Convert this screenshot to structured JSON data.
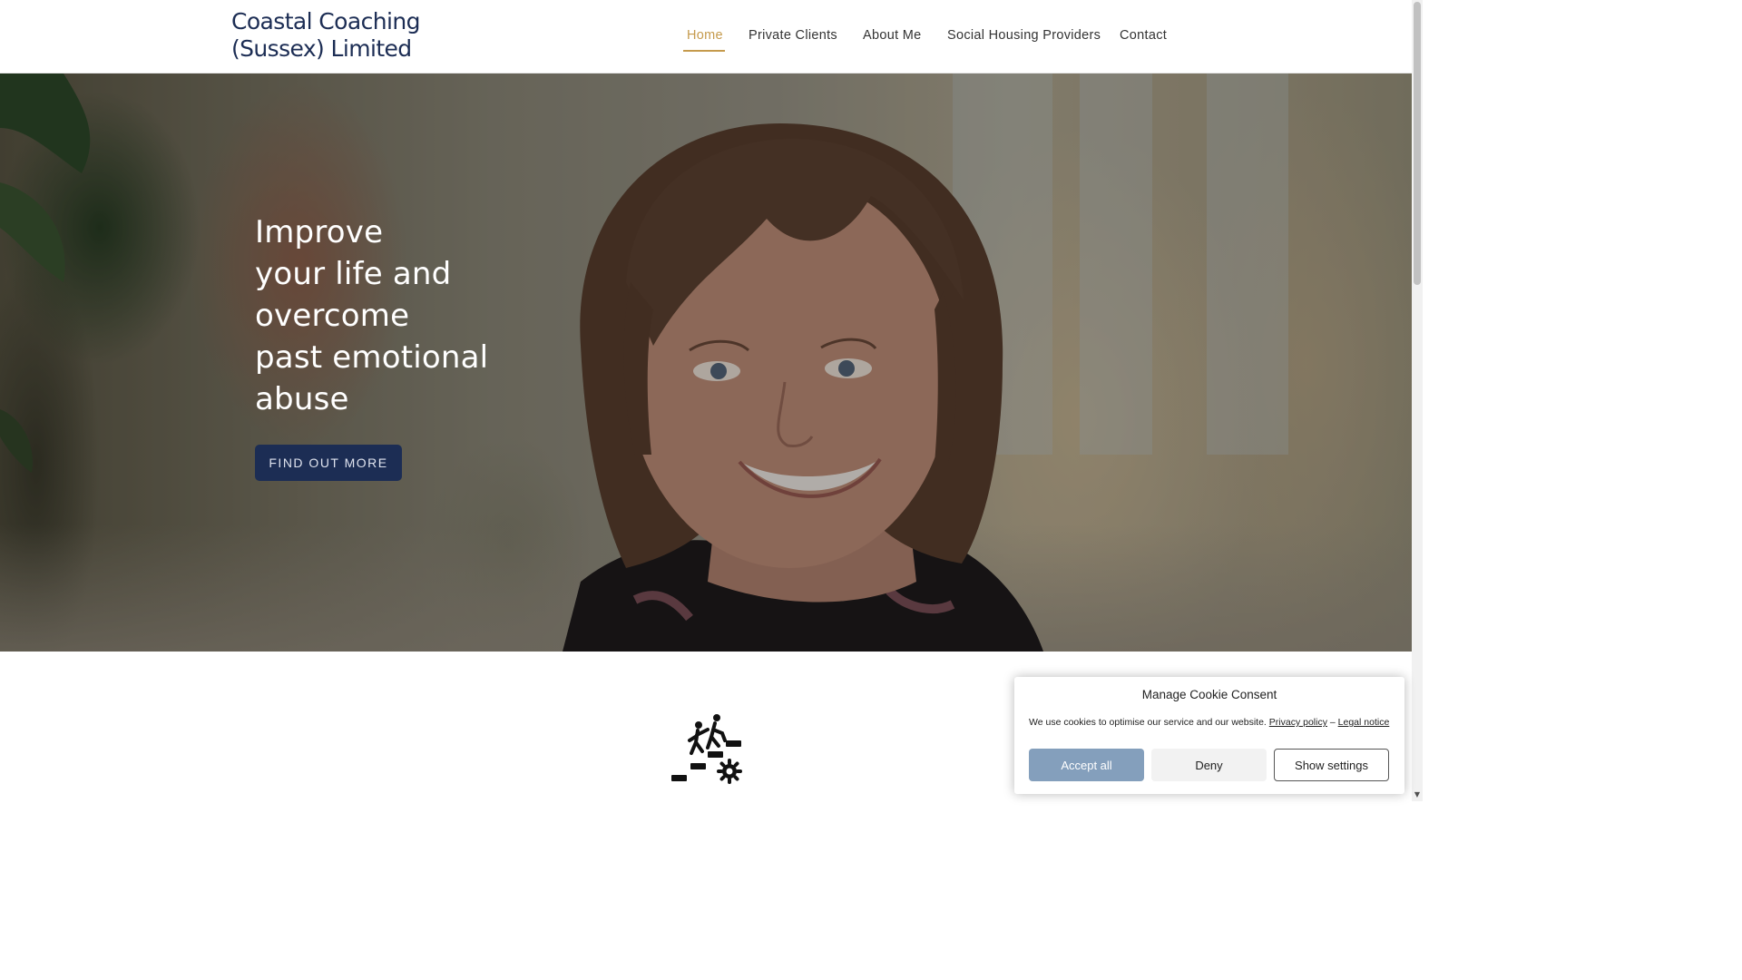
{
  "site": {
    "logo_line1": "Coastal Coaching",
    "logo_line2": "(Sussex) Limited"
  },
  "nav": {
    "items": [
      {
        "label": "Home",
        "active": true
      },
      {
        "label": "Private Clients",
        "active": false
      },
      {
        "label": "About Me",
        "active": false
      },
      {
        "label": "Social Housing Providers",
        "active": false
      },
      {
        "label": "Contact",
        "active": false
      }
    ],
    "active_color": "#c59a4c"
  },
  "hero": {
    "heading_lines": [
      "Improve",
      "your life and",
      "overcome",
      "past emotional",
      "abuse"
    ],
    "button_label": "FIND OUT MORE",
    "button_color": "#1c2d54",
    "image": "portrait-photo"
  },
  "section": {
    "icon": "coaching-stairs-icon"
  },
  "cookie": {
    "title": "Manage Cookie Consent",
    "text": "We use cookies to optimise our service and our website.",
    "privacy_link": "Privacy policy",
    "separator": "–",
    "legal_link": "Legal notice",
    "accept_label": "Accept all",
    "deny_label": "Deny",
    "settings_label": "Show settings",
    "accept_color": "#849fbc"
  },
  "colors": {
    "brand_navy": "#1c2d54",
    "accent_gold": "#c59a4c"
  }
}
